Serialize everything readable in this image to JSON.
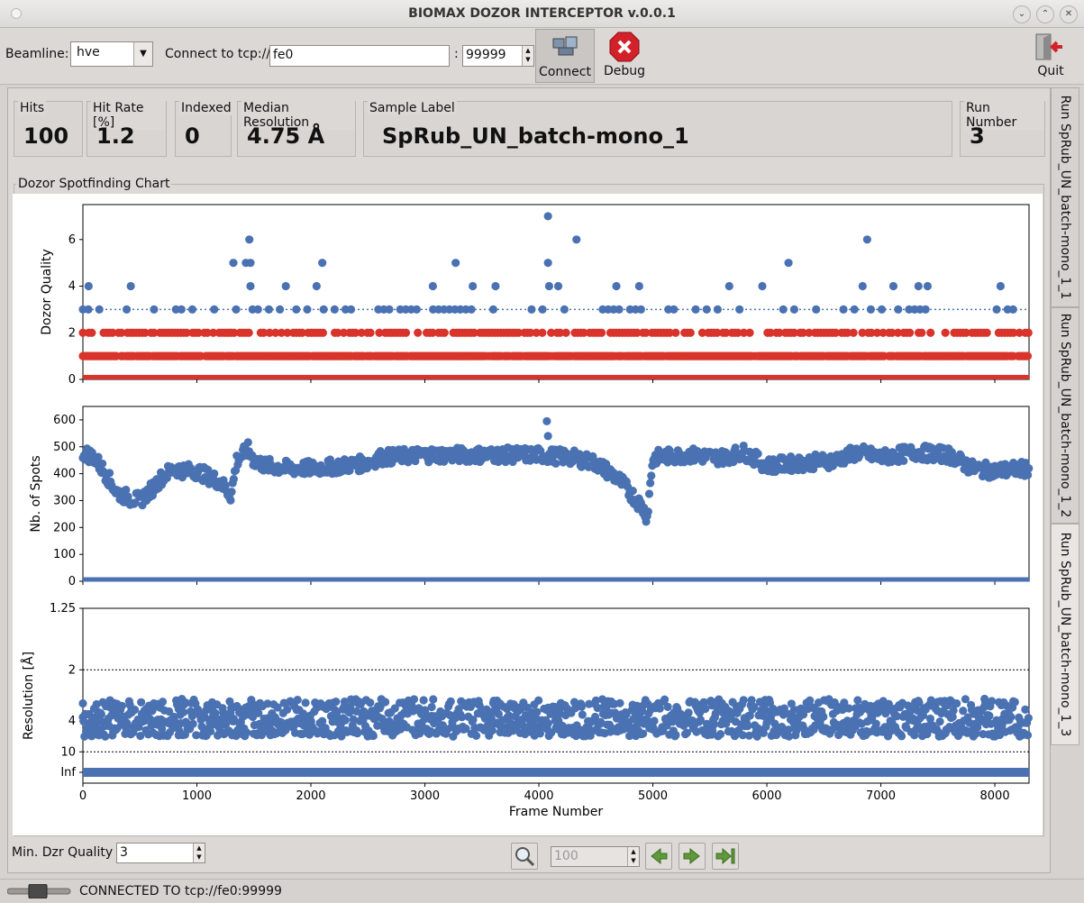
{
  "window": {
    "title": "BIOMAX DOZOR INTERCEPTOR v.0.0.1"
  },
  "toolbar": {
    "beamline_label": "Beamline:",
    "beamline_value": "hve",
    "connect_label": "Connect to tcp://",
    "host_value": "fe0",
    "port_sep": ":",
    "port_value": "99999",
    "connect_button": "Connect",
    "debug_button": "Debug",
    "quit_button": "Quit"
  },
  "stats": {
    "hits_label": "Hits",
    "hits_value": "100",
    "hitrate_label": "Hit Rate [%]",
    "hitrate_value": "1.2",
    "indexed_label": "Indexed",
    "indexed_value": "0",
    "resolution_label": "Median Resolution",
    "resolution_value": "4.75 Å",
    "sample_label": "Sample Label",
    "sample_value": "SpRub_UN_batch-mono_1",
    "run_label": "Run Number",
    "run_value": "3"
  },
  "chart_group_title": "Dozor Spotfinding Chart",
  "tabs": [
    {
      "label": "Run  SpRub_UN_batch-mono_1_1",
      "active": false
    },
    {
      "label": "Run  SpRub_UN_batch-mono_1_2",
      "active": false
    },
    {
      "label": "Run  SpRub_UN_batch-mono_1_3",
      "active": true
    }
  ],
  "controls": {
    "min_quality_label": "Min. Dzr Quality",
    "min_quality_value": "3",
    "zoom_value": "100"
  },
  "status": {
    "text": "CONNECTED TO tcp://fe0:99999"
  },
  "colors": {
    "blue": "#4a72b2",
    "red": "#d9342b"
  },
  "chart_data": [
    {
      "type": "scatter",
      "ylabel": "Dozor Quality",
      "xlim": [
        0,
        8300
      ],
      "ylim": [
        0,
        7.5
      ],
      "yticks": [
        "0",
        "2",
        "4",
        "6"
      ],
      "threshold": 3,
      "series": [
        {
          "color": "red",
          "points": [
            [
              0,
              0
            ],
            [
              8300,
              0
            ]
          ],
          "note_levels": [
            0,
            1,
            2
          ]
        },
        {
          "color": "blue",
          "points": [
            [
              50,
              4
            ],
            [
              420,
              4
            ],
            [
              1320,
              5
            ],
            [
              1430,
              5
            ],
            [
              1460,
              6
            ],
            [
              1470,
              5
            ],
            [
              1470,
              4
            ],
            [
              1780,
              4
            ],
            [
              2050,
              4
            ],
            [
              2100,
              5
            ],
            [
              3070,
              4
            ],
            [
              3270,
              5
            ],
            [
              3420,
              4
            ],
            [
              3620,
              4
            ],
            [
              4080,
              7
            ],
            [
              4080,
              5
            ],
            [
              4090,
              4
            ],
            [
              4170,
              4
            ],
            [
              4330,
              6
            ],
            [
              4680,
              4
            ],
            [
              4880,
              4
            ],
            [
              5670,
              4
            ],
            [
              5960,
              4
            ],
            [
              6190,
              5
            ],
            [
              6840,
              4
            ],
            [
              6880,
              6
            ],
            [
              7110,
              4
            ],
            [
              7330,
              4
            ],
            [
              7410,
              4
            ],
            [
              8050,
              4
            ]
          ]
        }
      ]
    },
    {
      "type": "scatter",
      "ylabel": "Nb. of Spots",
      "xlim": [
        0,
        8300
      ],
      "ylim": [
        0,
        650
      ],
      "yticks": [
        "0",
        "100",
        "200",
        "300",
        "400",
        "500",
        "600"
      ],
      "series": [
        {
          "color": "blue",
          "trend": [
            [
              0,
              480
            ],
            [
              100,
              460
            ],
            [
              200,
              400
            ],
            [
              300,
              330
            ],
            [
              400,
              310
            ],
            [
              500,
              300
            ],
            [
              600,
              340
            ],
            [
              700,
              390
            ],
            [
              800,
              420
            ],
            [
              900,
              410
            ],
            [
              1000,
              410
            ],
            [
              1100,
              390
            ],
            [
              1200,
              370
            ],
            [
              1300,
              320
            ],
            [
              1350,
              450
            ],
            [
              1450,
              490
            ],
            [
              1500,
              450
            ],
            [
              1600,
              430
            ],
            [
              1800,
              420
            ],
            [
              2000,
              420
            ],
            [
              2300,
              430
            ],
            [
              2500,
              440
            ],
            [
              2600,
              460
            ],
            [
              3000,
              470
            ],
            [
              3500,
              470
            ],
            [
              4000,
              470
            ],
            [
              4300,
              460
            ],
            [
              4500,
              440
            ],
            [
              4700,
              380
            ],
            [
              4900,
              280
            ],
            [
              4950,
              240
            ],
            [
              5000,
              460
            ],
            [
              5300,
              470
            ],
            [
              5600,
              460
            ],
            [
              5800,
              480
            ],
            [
              6000,
              430
            ],
            [
              6300,
              440
            ],
            [
              6600,
              450
            ],
            [
              6800,
              480
            ],
            [
              7000,
              460
            ],
            [
              7300,
              480
            ],
            [
              7600,
              470
            ],
            [
              7800,
              420
            ],
            [
              8000,
              410
            ],
            [
              8300,
              420
            ]
          ],
          "outliers": [
            [
              4070,
              595
            ],
            [
              4080,
              540
            ]
          ],
          "baseline": 5
        }
      ]
    },
    {
      "type": "scatter",
      "ylabel": "Resolution [Å]",
      "xlabel": "Frame Number",
      "xlim": [
        0,
        8300
      ],
      "xticks": [
        "0",
        "1000",
        "2000",
        "3000",
        "4000",
        "5000",
        "6000",
        "7000",
        "8000"
      ],
      "yticks": [
        "1.25",
        "2",
        "4",
        "10",
        "Inf"
      ],
      "thresholds": [
        "2",
        "10"
      ],
      "series": [
        {
          "color": "blue",
          "band": "around 4",
          "baseline": "Inf"
        }
      ]
    }
  ]
}
